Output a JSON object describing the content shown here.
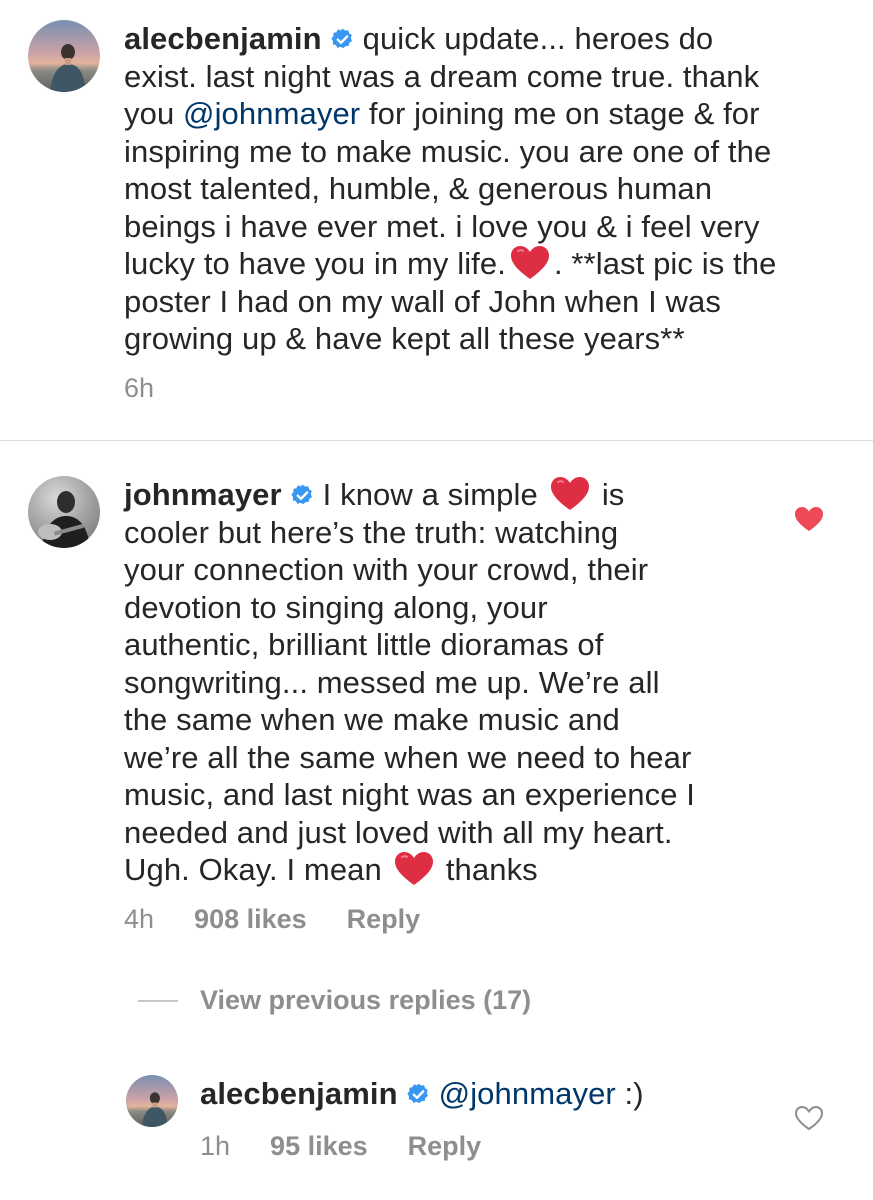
{
  "comments": [
    {
      "username": "alecbenjamin",
      "verified": true,
      "text_lines": [
        "quick update... heroes do",
        "exist. last night was a dream come true. thank",
        "you ",
        "@johnmayer",
        " for joining me on stage & for",
        "inspiring me to make music. you are one of the",
        "most talented, humble, & generous human",
        "beings i have ever met. i love you & i feel very",
        "lucky to have you in my life.",
        ". **last pic is the",
        "poster I had on my wall of John when I was",
        "growing up & have kept all these years**"
      ],
      "time": "6h"
    },
    {
      "username": "johnmayer",
      "verified": true,
      "text_lines": [
        "I know a simple",
        "is",
        "cooler but here’s the truth: watching",
        "your connection with your crowd, their",
        "devotion to singing along, your",
        "authentic, brilliant little dioramas of",
        "songwriting... messed me up. We’re all",
        "the same when we make music and",
        "we’re all the same when we need to hear",
        "music, and last night was an experience I",
        "needed and just loved with all my heart.",
        "Ugh. Okay. I mean",
        "thanks"
      ],
      "time": "4h",
      "likes": "908 likes",
      "reply_label": "Reply",
      "liked": true
    }
  ],
  "view_previous": "View previous replies (17)",
  "reply": {
    "username": "alecbenjamin",
    "verified": true,
    "mention": "@johnmayer",
    "text": " :)",
    "time": "1h",
    "likes": "95 likes",
    "reply_label": "Reply",
    "liked": false
  },
  "colors": {
    "text": "#262626",
    "secondary": "#8e8e8e",
    "mention": "#00376b",
    "verified": "#3897f0",
    "heart_red": "#ed4956",
    "divider": "#dbdbdb"
  },
  "icons": {
    "verified": "verified-badge-icon",
    "heart_emoji": "red-heart-emoji",
    "like_filled": "heart-filled-icon",
    "like_outline": "heart-outline-icon"
  }
}
